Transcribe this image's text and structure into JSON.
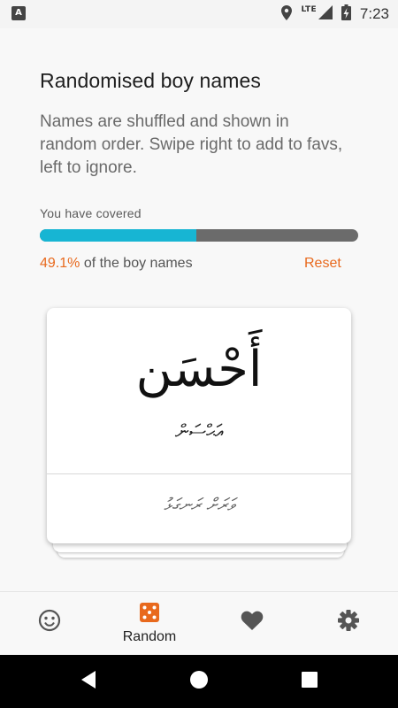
{
  "status_bar": {
    "notification_icon": "a-box-icon",
    "network_label": "LTE",
    "time": "7:23"
  },
  "header": {
    "title": "Randomised boy names",
    "description": "Names are shuffled and shown in random order. Swipe right to add to favs, left to ignore."
  },
  "progress": {
    "label": "You have covered",
    "fraction": 0.491,
    "percent_text": "49.1%",
    "suffix_text": " of the boy names",
    "reset_label": "Reset",
    "fill_color": "#17b5d3",
    "track_color": "#6b6b6b",
    "accent_color": "#e8691d"
  },
  "card": {
    "arabic_name": "أَحْسَن",
    "thaana_name": "އަޙްސަން",
    "thaana_meaning": "ވަރަށް ރަނގަޅު"
  },
  "bottom_nav": {
    "items": [
      {
        "icon": "smiley-icon",
        "label": ""
      },
      {
        "icon": "dice-icon",
        "label": "Random",
        "active": true
      },
      {
        "icon": "heart-icon",
        "label": ""
      },
      {
        "icon": "gear-icon",
        "label": ""
      }
    ]
  },
  "system_nav": {
    "back_icon": "back-triangle-icon",
    "home_icon": "home-circle-icon",
    "recents_icon": "recents-square-icon"
  }
}
